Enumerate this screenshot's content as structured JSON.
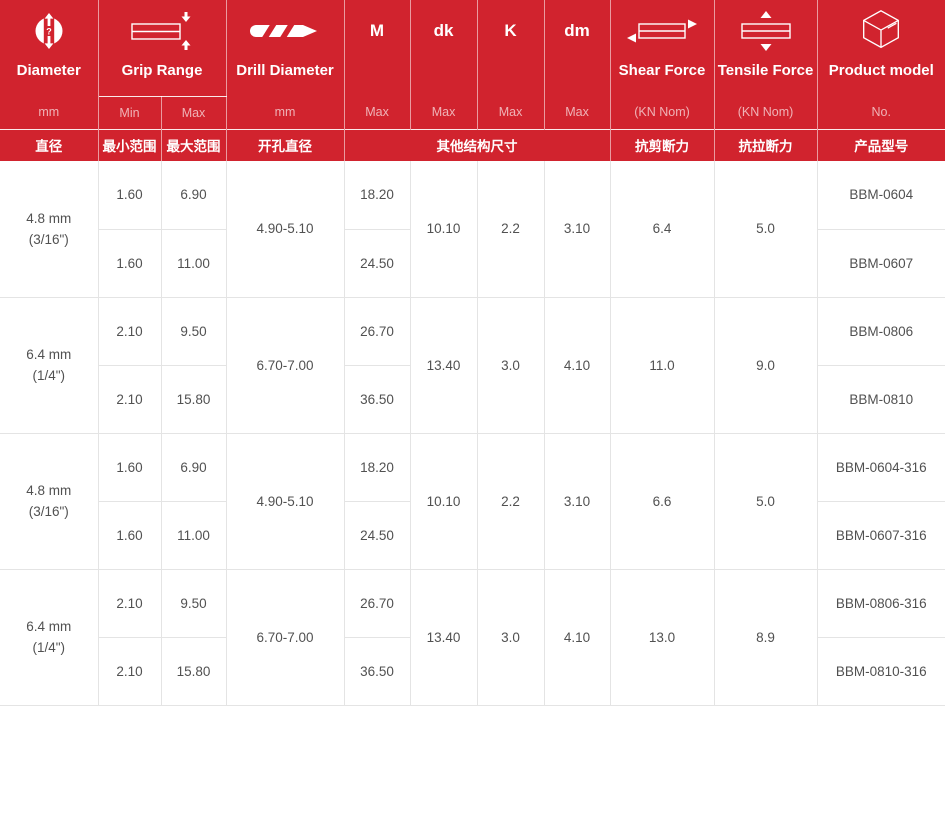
{
  "colors": {
    "brand_red": "#d1232e"
  },
  "table": {
    "header": {
      "diameter": {
        "label": "Diameter",
        "unit": "mm",
        "zh": "直径"
      },
      "grip": {
        "label": "Grip Range",
        "min": "Min",
        "max": "Max",
        "zh_min": "最小范围",
        "zh_max": "最大范围"
      },
      "drill": {
        "label": "Drill Diameter",
        "unit": "mm",
        "zh": "开孔直径"
      },
      "m": {
        "label": "M",
        "sub": "Max"
      },
      "dk": {
        "label": "dk",
        "sub": "Max"
      },
      "k": {
        "label": "K",
        "sub": "Max"
      },
      "dm": {
        "label": "dm",
        "sub": "Max"
      },
      "shear": {
        "label": "Shear Force",
        "sub": "(KN Nom)",
        "zh": "抗剪断力"
      },
      "tensile": {
        "label": "Tensile Force",
        "sub": "(KN Nom)",
        "zh": "抗拉断力"
      },
      "product": {
        "label": "Product model",
        "sub": "No.",
        "zh": "产品型号"
      },
      "other_dims_zh": "其他结构尺寸"
    },
    "groups": [
      {
        "diameter": "4.8 mm",
        "diameter_inch": "(3/16\")",
        "drill": "4.90-5.10",
        "dk": "10.10",
        "k": "2.2",
        "dm": "3.10",
        "shear": "6.4",
        "tensile": "5.0",
        "rows": [
          {
            "min": "1.60",
            "max": "6.90",
            "m": "18.20",
            "model": "BBM-0604"
          },
          {
            "min": "1.60",
            "max": "11.00",
            "m": "24.50",
            "model": "BBM-0607"
          }
        ]
      },
      {
        "diameter": "6.4 mm",
        "diameter_inch": "(1/4\")",
        "drill": "6.70-7.00",
        "dk": "13.40",
        "k": "3.0",
        "dm": "4.10",
        "shear": "11.0",
        "tensile": "9.0",
        "rows": [
          {
            "min": "2.10",
            "max": "9.50",
            "m": "26.70",
            "model": "BBM-0806"
          },
          {
            "min": "2.10",
            "max": "15.80",
            "m": "36.50",
            "model": "BBM-0810"
          }
        ]
      },
      {
        "diameter": "4.8 mm",
        "diameter_inch": "(3/16\")",
        "drill": "4.90-5.10",
        "dk": "10.10",
        "k": "2.2",
        "dm": "3.10",
        "shear": "6.6",
        "tensile": "5.0",
        "rows": [
          {
            "min": "1.60",
            "max": "6.90",
            "m": "18.20",
            "model": "BBM-0604-316"
          },
          {
            "min": "1.60",
            "max": "11.00",
            "m": "24.50",
            "model": "BBM-0607-316"
          }
        ]
      },
      {
        "diameter": "6.4 mm",
        "diameter_inch": "(1/4\")",
        "drill": "6.70-7.00",
        "dk": "13.40",
        "k": "3.0",
        "dm": "4.10",
        "shear": "13.0",
        "tensile": "8.9",
        "rows": [
          {
            "min": "2.10",
            "max": "9.50",
            "m": "26.70",
            "model": "BBM-0806-316"
          },
          {
            "min": "2.10",
            "max": "15.80",
            "m": "36.50",
            "model": "BBM-0810-316"
          }
        ]
      }
    ]
  }
}
